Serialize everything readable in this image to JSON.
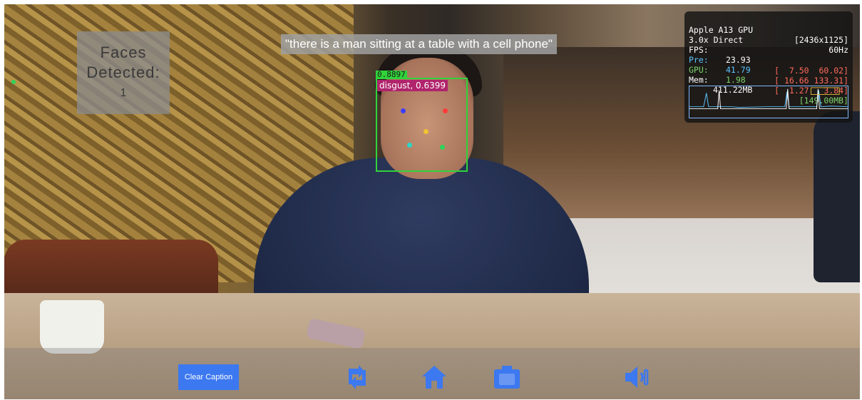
{
  "faces_panel": {
    "title": "Faces Detected:",
    "count": "1"
  },
  "caption": {
    "text": "\"there is a man sitting at a table with a cell phone\""
  },
  "detection": {
    "score": "0.8897",
    "emotion": "disgust, 0.6399"
  },
  "perf_overlay": {
    "device": "Apple A13 GPU",
    "resolution": "[2436x1125]",
    "mode": "3.0x Direct",
    "refresh": "60Hz",
    "fps_label": "FPS:",
    "fps_value": "23.93",
    "fps_range": "[  7.50  60.02]",
    "pre_label": "Pre:",
    "pre_value": "41.79",
    "pre_range": "[ 16.66 133.31]",
    "gpu_label": "GPU:",
    "gpu_value": "1.98",
    "gpu_range": "[  1.27   3.84]",
    "mem_label": "Mem:",
    "mem_value": "411.22MB",
    "mem_peak": "[149.00MB]"
  },
  "toolbar": {
    "clear_caption_label": "Clear Caption",
    "icons": [
      "switch-camera-icon",
      "home-icon",
      "camera-icon",
      "speaker-icon"
    ]
  },
  "colors": {
    "accent": "#3c78f0",
    "box": "#30d33a",
    "emotion_tag": "#b0246c"
  }
}
